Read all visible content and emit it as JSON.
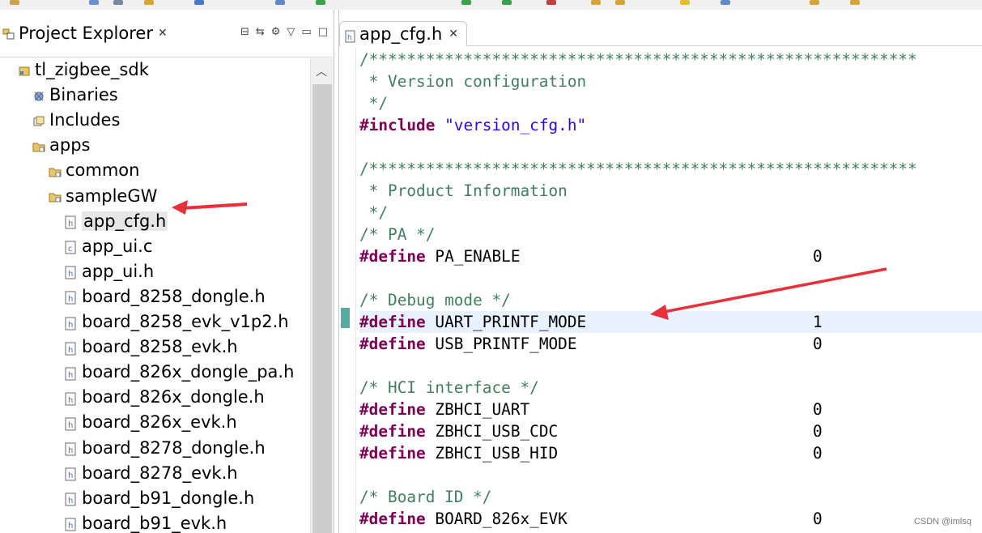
{
  "explorer": {
    "title": "Project Explorer",
    "tree": [
      {
        "label": "tl_zigbee_sdk",
        "icon": "project-icon",
        "depth": 0
      },
      {
        "label": "Binaries",
        "icon": "binaries-icon",
        "depth": 1
      },
      {
        "label": "Includes",
        "icon": "includes-icon",
        "depth": 1
      },
      {
        "label": "apps",
        "icon": "folder-icon",
        "depth": 1
      },
      {
        "label": "common",
        "icon": "folder-icon",
        "depth": 2
      },
      {
        "label": "sampleGW",
        "icon": "folder-icon",
        "depth": 2
      },
      {
        "label": "app_cfg.h",
        "icon": "header-file-icon",
        "depth": 3,
        "selected": true
      },
      {
        "label": "app_ui.c",
        "icon": "c-file-icon",
        "depth": 3
      },
      {
        "label": "app_ui.h",
        "icon": "header-file-icon",
        "depth": 3
      },
      {
        "label": "board_8258_dongle.h",
        "icon": "header-file-icon",
        "depth": 3
      },
      {
        "label": "board_8258_evk_v1p2.h",
        "icon": "header-file-icon",
        "depth": 3
      },
      {
        "label": "board_8258_evk.h",
        "icon": "header-file-icon",
        "depth": 3
      },
      {
        "label": "board_826x_dongle_pa.h",
        "icon": "header-file-icon",
        "depth": 3
      },
      {
        "label": "board_826x_dongle.h",
        "icon": "header-file-icon",
        "depth": 3
      },
      {
        "label": "board_826x_evk.h",
        "icon": "header-file-icon",
        "depth": 3
      },
      {
        "label": "board_8278_dongle.h",
        "icon": "header-file-icon",
        "depth": 3
      },
      {
        "label": "board_8278_evk.h",
        "icon": "header-file-icon",
        "depth": 3
      },
      {
        "label": "board_b91_dongle.h",
        "icon": "header-file-icon",
        "depth": 3
      },
      {
        "label": "board_b91_evk.h",
        "icon": "header-file-icon",
        "depth": 3
      }
    ]
  },
  "editor": {
    "tab_title": "app_cfg.h",
    "lines": [
      {
        "kind": "comment",
        "text": "/**********************************************************"
      },
      {
        "kind": "comment",
        "text": " * Version configuration"
      },
      {
        "kind": "comment",
        "text": " */"
      },
      {
        "kind": "include",
        "kw": "#include",
        "str": "\"version_cfg.h\""
      },
      {
        "kind": "blank"
      },
      {
        "kind": "comment",
        "text": "/**********************************************************"
      },
      {
        "kind": "comment",
        "text": " * Product Information"
      },
      {
        "kind": "comment",
        "text": " */"
      },
      {
        "kind": "comment",
        "text": "/* PA */"
      },
      {
        "kind": "define",
        "kw": "#define",
        "name": "PA_ENABLE",
        "value": "0"
      },
      {
        "kind": "blank"
      },
      {
        "kind": "comment",
        "text": "/* Debug mode */"
      },
      {
        "kind": "define",
        "kw": "#define",
        "name": "UART_PRINTF_MODE",
        "value": "1",
        "highlight": true
      },
      {
        "kind": "define",
        "kw": "#define",
        "name": "USB_PRINTF_MODE",
        "value": "0"
      },
      {
        "kind": "blank"
      },
      {
        "kind": "comment",
        "text": "/* HCI interface */"
      },
      {
        "kind": "define",
        "kw": "#define",
        "name": "ZBHCI_UART",
        "value": "0"
      },
      {
        "kind": "define",
        "kw": "#define",
        "name": "ZBHCI_USB_CDC",
        "value": "0"
      },
      {
        "kind": "define",
        "kw": "#define",
        "name": "ZBHCI_USB_HID",
        "value": "0"
      },
      {
        "kind": "blank"
      },
      {
        "kind": "comment",
        "text": "/* Board ID */"
      },
      {
        "kind": "define",
        "kw": "#define",
        "name": "BOARD_826x_EVK",
        "value": "0"
      }
    ]
  },
  "watermark": "CSDN @imlsq",
  "colors": {
    "comment": "#3f7f5f",
    "keyword": "#7f0055",
    "string": "#2a00ff",
    "highlight": "#e8f2fe",
    "arrow": "#e8303a"
  }
}
